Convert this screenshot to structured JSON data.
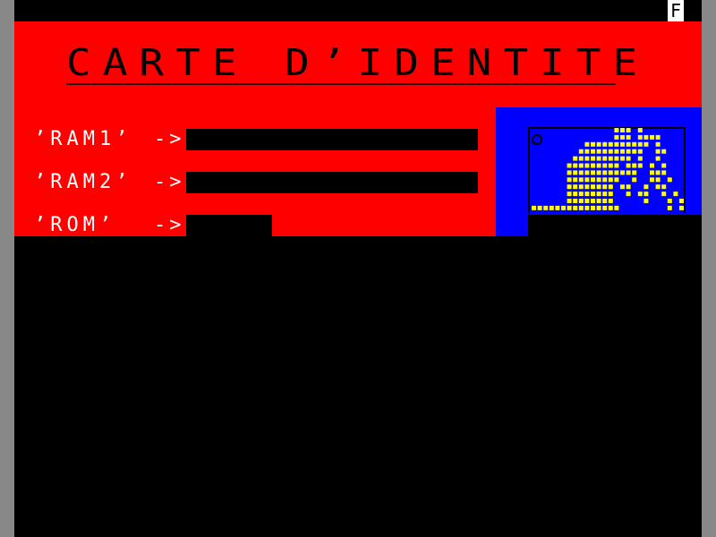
{
  "screen": {
    "mode_indicator": "F",
    "title": "CARTE D’IDENTITE",
    "rows": [
      {
        "label": "’RAM1’",
        "arrow": "->"
      },
      {
        "label": "’RAM2’",
        "arrow": "->"
      },
      {
        "label": "’ROM’",
        "arrow": "->"
      }
    ]
  },
  "colors": {
    "background": "#000000",
    "banner": "#ff0000",
    "logo_panel": "#0000ff",
    "logo_dots": "#ffff00",
    "text": "#ffffff"
  },
  "icons": {
    "logo": "pixel-logo-icon"
  }
}
